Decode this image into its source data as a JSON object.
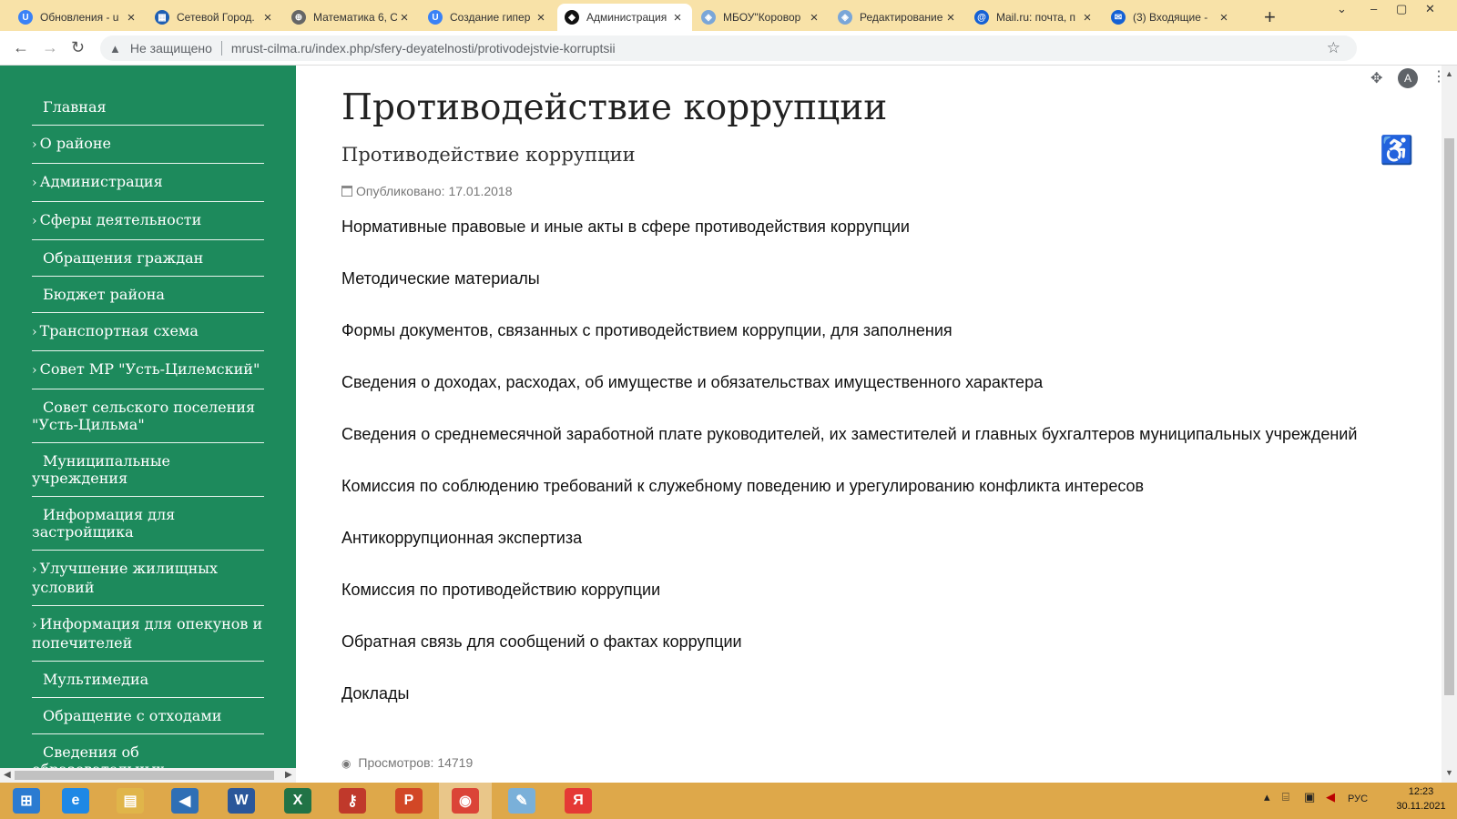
{
  "browser": {
    "tabs": [
      {
        "label": "Обновления - u",
        "icon": "u-icon",
        "color": "#3b82f6",
        "glyph": "U"
      },
      {
        "label": "Сетевой Город.",
        "icon": "city-icon",
        "color": "#1e5fb3",
        "glyph": "▦"
      },
      {
        "label": "Математика 6, С",
        "icon": "globe-icon",
        "color": "#666",
        "glyph": "⊕"
      },
      {
        "label": "Создание гипер",
        "icon": "u-icon",
        "color": "#3b82f6",
        "glyph": "U"
      },
      {
        "label": "Администрация",
        "icon": "site-icon",
        "color": "#111",
        "glyph": "◆",
        "active": true
      },
      {
        "label": "МБОУ\"Коровор",
        "icon": "shield-icon",
        "color": "#7aa6d8",
        "glyph": "◈"
      },
      {
        "label": "Редактирование",
        "icon": "shield-icon",
        "color": "#7aa6d8",
        "glyph": "◈"
      },
      {
        "label": "Mail.ru: почта, п",
        "icon": "at-icon",
        "color": "#1561d4",
        "glyph": "@"
      },
      {
        "label": "(3) Входящие - ",
        "icon": "mail-icon",
        "color": "#1561d4",
        "glyph": "✉"
      }
    ],
    "new_tab": "+",
    "insecure_label": "Не защищено",
    "url": "mrust-cilma.ru/index.php/sfery-deyatelnosti/protivodejstvie-korruptsii",
    "avatar_letter": "А"
  },
  "sidebar": {
    "items": [
      {
        "label": "Главная",
        "arrow": false
      },
      {
        "label": "О районе",
        "arrow": true
      },
      {
        "label": "Администрация",
        "arrow": true
      },
      {
        "label": "Сферы деятельности",
        "arrow": true
      },
      {
        "label": "Обращения граждан",
        "arrow": false
      },
      {
        "label": "Бюджет района",
        "arrow": false
      },
      {
        "label": "Транспортная схема",
        "arrow": true
      },
      {
        "label": "Совет МР \"Усть-Цилемский\"",
        "arrow": true
      },
      {
        "label": "Совет сельского поселения \"Усть-Цильма\"",
        "arrow": false
      },
      {
        "label": "Муниципальные учреждения",
        "arrow": false
      },
      {
        "label": "Информация для застройщика",
        "arrow": false
      },
      {
        "label": "Улучшение жилищных условий",
        "arrow": true
      },
      {
        "label": "Информация для опекунов и попечителей",
        "arrow": true
      },
      {
        "label": "Мультимедиа",
        "arrow": false
      },
      {
        "label": "Обращение с отходами",
        "arrow": false
      },
      {
        "label": "Сведения об образовательных организациях, детских медицинских, санаторно-курортных, физкультурно - спортивных организациях",
        "arrow": false
      }
    ]
  },
  "article": {
    "title": "Противодействие коррупции",
    "subtitle": "Противодействие коррупции",
    "published": "Опубликовано: 17.01.2018",
    "links": [
      "Нормативные правовые и иные акты в сфере противодействия коррупции",
      "Методические материалы",
      "Формы документов, связанных с противодействием коррупции, для заполнения",
      "Сведения о доходах, расходах, об имуществе и обязательствах имущественного характера",
      "Сведения о среднемесячной заработной плате руководителей, их заместителей и главных бухгалтеров муниципальных учреждений",
      "Комиссия по соблюдению требований к служебному поведению и урегулированию конфликта интересов",
      "Антикоррупционная экспертиза",
      "Комиссия по противодействию коррупции",
      "Обратная связь для сообщений о фактах коррупции",
      "Доклады"
    ],
    "views": "Просмотров: 14719"
  },
  "taskbar": {
    "apps": [
      {
        "name": "start-icon",
        "color": "#2b7bd1",
        "glyph": "⊞"
      },
      {
        "name": "ie-icon",
        "color": "#1e88e5",
        "glyph": "e"
      },
      {
        "name": "explorer-icon",
        "color": "#e0b54a",
        "glyph": "▤"
      },
      {
        "name": "media-player-icon",
        "color": "#2f6fb5",
        "glyph": "◀"
      },
      {
        "name": "word-icon",
        "color": "#2b579a",
        "glyph": "W"
      },
      {
        "name": "excel-icon",
        "color": "#217346",
        "glyph": "X"
      },
      {
        "name": "key-icon",
        "color": "#c0392b",
        "glyph": "⚷"
      },
      {
        "name": "powerpoint-icon",
        "color": "#d24726",
        "glyph": "P"
      },
      {
        "name": "chrome-icon",
        "color": "#db4437",
        "glyph": "◉",
        "active": true
      },
      {
        "name": "paint-icon",
        "color": "#7ab0d9",
        "glyph": "✎"
      },
      {
        "name": "yandex-icon",
        "color": "#e53935",
        "glyph": "Я"
      }
    ],
    "lang": "РУС",
    "time": "12:23",
    "date": "30.11.2021"
  }
}
